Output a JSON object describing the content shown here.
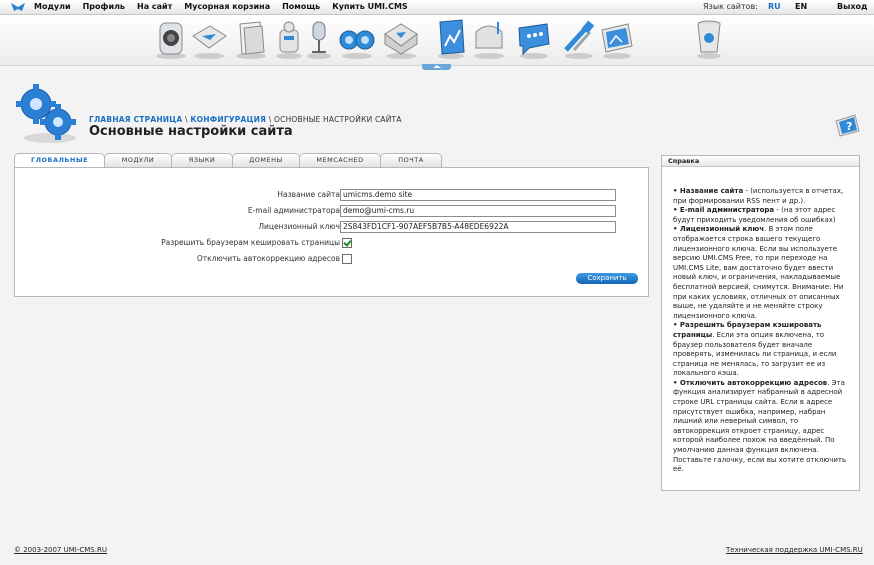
{
  "topbar": {
    "menu": [
      "Модули",
      "Профиль",
      "На сайт",
      "Мусорная корзина",
      "Помощь",
      "Купить UMI.CMS"
    ],
    "lang_label": "Язык сайтов:",
    "lang_ru": "RU",
    "lang_en": "EN",
    "exit": "Выход"
  },
  "toolbar": {
    "icons": [
      "speaker-icon",
      "mail-folder-icon",
      "folders-icon",
      "puzzle-robot-icon",
      "microphone-icon",
      "binoculars-icon",
      "inbox-icon",
      "stats-chart-icon",
      "mailbox-icon",
      "chat-bubble-icon",
      "tools-icon",
      "photo-icon",
      "trash-icon"
    ]
  },
  "breadcrumb": {
    "home": "ГЛАВНАЯ СТРАНИЦА",
    "sep1": " \\ ",
    "config": "КОНФИГУРАЦИЯ",
    "sep2": " \\ ",
    "current": "ОСНОВНЫЕ НАСТРОЙКИ САЙТА"
  },
  "page_title": "Основные настройки сайта",
  "tabs": [
    "ГЛОБАЛЬНЫЕ",
    "МОДУЛИ",
    "ЯЗЫКИ",
    "ДОМЕНЫ",
    "MEMCACHED",
    "ПОЧТА"
  ],
  "form": {
    "site_name_label": "Название сайта",
    "site_name_value": "umicms.demo site",
    "admin_email_label": "E-mail администратора",
    "admin_email_value": "demo@umi-cms.ru",
    "license_label": "Лицензионный ключ",
    "license_value": "2S843FD1CF1-907AEF5B7B5-A48EDE6922A",
    "cache_label": "Разрешить браузерам кешировать страницы",
    "cache_checked": true,
    "autocorrect_label": "Отключить автокоррекцию адресов",
    "autocorrect_checked": false,
    "save_label": "Сохранить"
  },
  "help": {
    "title": "Справка",
    "items": [
      {
        "term": "Название сайта",
        "text": " - (используется в отчетах, при формировании RSS пент и др.)."
      },
      {
        "term": "E-mail администратора",
        "text": " - (на этот адрес будут приходить уведомления об ошибках)"
      },
      {
        "term": "Лицензионный ключ",
        "text": ". В этом поле отображается строка вашего текущего лицензионного ключа. Если вы используете версию UMI.CMS Free, то при переходе на UMI.CMS Lite, вам достаточно будет ввести новый ключ, и ограничения, накладываемые бесплатной версией, снимутся. Внимание: Ни при каких условиях, отличных от описанных выше, не удаляйте и не меняйте строку лицензионного ключа."
      },
      {
        "term": "Разрешить браузерам кэшировать страницы",
        "text": ". Если эта опция включена, то браузер пользователя будет вначале проверять, изменилась ли страница, и если страница не менялась, то загрузит ее из локального кэша."
      },
      {
        "term": "Отключить автокоррекцию адресов",
        "text": ". Эта функция анализирует набранный в адресной строке URL страницы сайта. Если в адресе присутствует ошибка, например, набран лишний или неверный символ, то автокоррекция откроет страницу, адрес которой наиболее похож на введённый. По умолчанию данная функция включена. Поставьте галочку, если вы хотите отключить её."
      }
    ]
  },
  "footer": {
    "copyright": "© 2003-2007 UMI-CMS.RU",
    "support": "Техническая поддержка UMI-CMS.RU"
  },
  "colors": {
    "accent": "#1a6fc4",
    "button": "#1f78cc"
  }
}
